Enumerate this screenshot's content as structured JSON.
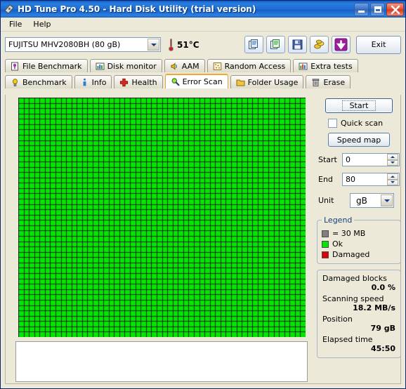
{
  "window": {
    "title": "HD Tune Pro 4.50 - Hard Disk Utility (trial version)",
    "icon": "disk-icon",
    "minimize_label": "_",
    "maximize_label": "□",
    "close_label": "×"
  },
  "menu": {
    "items": [
      {
        "label": "File"
      },
      {
        "label": "Help"
      }
    ]
  },
  "toolbar": {
    "drive": "FUJITSU MHV2080BH (80 gB)",
    "temperature": "51°C",
    "buttons": [
      {
        "name": "copy-to-clipboard-button",
        "icon": "copy-icon"
      },
      {
        "name": "copy-to-excel-button",
        "icon": "excel-copy-icon"
      },
      {
        "name": "save-button",
        "icon": "floppy-save-icon"
      },
      {
        "name": "options-button",
        "icon": "gold-coins-icon"
      },
      {
        "name": "download-button",
        "icon": "purple-down-arrow-icon"
      }
    ],
    "exit_label": "Exit"
  },
  "tabs": {
    "row1": [
      {
        "label": "File Benchmark",
        "icon": "file-benchmark-icon",
        "active": false
      },
      {
        "label": "Disk monitor",
        "icon": "bar-chart-icon",
        "active": false
      },
      {
        "label": "AAM",
        "icon": "speaker-icon",
        "active": false
      },
      {
        "label": "Random Access",
        "icon": "dots-icon",
        "active": false
      },
      {
        "label": "Extra tests",
        "icon": "extra-tests-icon",
        "active": false
      }
    ],
    "row2": [
      {
        "label": "Benchmark",
        "icon": "bulb-icon",
        "active": false
      },
      {
        "label": "Info",
        "icon": "info-icon",
        "active": false
      },
      {
        "label": "Health",
        "icon": "red-cross-icon",
        "active": false
      },
      {
        "label": "Error Scan",
        "icon": "magnifier-icon",
        "active": true
      },
      {
        "label": "Folder Usage",
        "icon": "folder-icon",
        "active": false
      },
      {
        "label": "Erase",
        "icon": "trash-icon",
        "active": false
      }
    ]
  },
  "panel": {
    "start_label": "Start",
    "quick_scan_label": "Quick scan",
    "quick_scan_checked": false,
    "speed_map_label": "Speed map",
    "range_start_label": "Start",
    "range_start_value": "0",
    "range_end_label": "End",
    "range_end_value": "80",
    "unit_label": "Unit",
    "unit_value": "gB"
  },
  "legend": {
    "title": "Legend",
    "items": [
      {
        "color": "#808080",
        "label": "= 30 MB",
        "swatch": "gray"
      },
      {
        "color": "#00e800",
        "label": "Ok",
        "swatch": "green"
      },
      {
        "color": "#e00000",
        "label": "Damaged",
        "swatch": "red"
      }
    ]
  },
  "stats": {
    "rows": [
      {
        "label": "Damaged blocks",
        "value": "0.0 %"
      },
      {
        "label": "Scanning speed",
        "value": "18.2 MB/s"
      },
      {
        "label": "Position",
        "value": "79 gB"
      },
      {
        "label": "Elapsed time",
        "value": "45:50"
      }
    ]
  },
  "scan_grid": {
    "columns": 54,
    "rows": 45,
    "block_color": "#00e800",
    "grid_line_color": "#202020",
    "damaged_color": "#e00000",
    "scanned_fraction": 1.0,
    "log_text": ""
  }
}
